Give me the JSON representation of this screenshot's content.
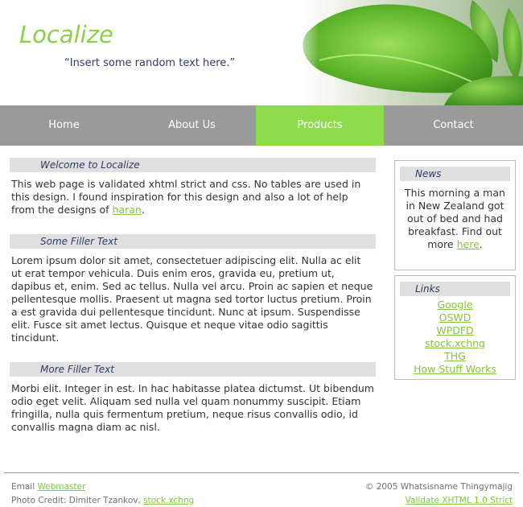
{
  "header": {
    "logo": "Localize",
    "slogan": "“Insert some random text here.”"
  },
  "nav": {
    "items": [
      {
        "label": "Home"
      },
      {
        "label": "About Us"
      },
      {
        "label": "Products",
        "active": true
      },
      {
        "label": "Contact"
      }
    ]
  },
  "main": {
    "sections": [
      {
        "title": "Welcome to Localize",
        "text": "This web page is validated xhtml strict and css. No tables are used in this design. I found inspiration for this design and also a lot of help from the designs of ",
        "link": "haran",
        "after": "."
      },
      {
        "title": "Some Filler Text",
        "text": "Lorem ipsum dolor sit amet, consectetuer adipiscing elit. Nulla ac elit ut erat tempor vehicula. Duis enim eros, gravida eu, pretium ut, dapibus et, enim. Sed ac tellus. Nulla vel arcu. Proin ac sapien et neque pellentesque mollis. Praesent ut magna sed tortor luctus pretium. Proin a est gravida dui pellentesque tincidunt. Nunc at ipsum. Suspendisse elit. Fusce sit amet lectus. Quisque et neque vitae odio sagittis tincidunt."
      },
      {
        "title": "More Filler Text",
        "text": "Morbi elit. Integer in est. In hac habitasse platea dictumst. Ut bibendum odio eget velit. Aliquam sed nulla vel quam nonummy suscipit. Etiam fringilla, nulla quis fermentum pretium, neque risus convallis odio, id convallis magna diam ac nisl."
      }
    ]
  },
  "sidebar": {
    "news": {
      "title": "News",
      "text": "This morning a man in New Zealand got out of bed and had breakfast. Find out more ",
      "link": "here",
      "after": "."
    },
    "links": {
      "title": "Links",
      "items": [
        "Google",
        "OSWD",
        "WPDFD",
        "stock.xchng",
        "THG",
        "How Stuff Works"
      ]
    }
  },
  "footer": {
    "email_label": "Email ",
    "email_link": "Webmaster",
    "credit_label": "Photo Credit: Dimiter Tzankov, ",
    "credit_link": "stock.xchng",
    "copyright": "© 2005 Whatsisname Thingymajig",
    "validate": "Validate XHTML 1.0 Strict"
  },
  "colors": {
    "accent": "#8ddc4a",
    "nav": "#9a9a9a",
    "title_text": "#2f3a6a"
  }
}
